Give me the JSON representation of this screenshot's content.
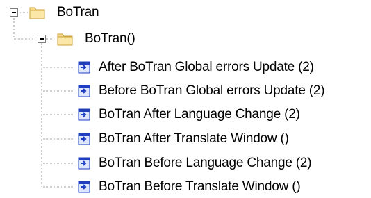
{
  "tree": {
    "root": {
      "label": "BoTran",
      "icon": "folder-icon",
      "expanded": true,
      "children": [
        {
          "label": "BoTran()",
          "icon": "folder-icon",
          "expanded": true,
          "children": [
            {
              "label": "After BoTran Global errors Update (2)",
              "icon": "item-icon"
            },
            {
              "label": "Before BoTran Global errors Update (2)",
              "icon": "item-icon"
            },
            {
              "label": "BoTran After Language Change (2)",
              "icon": "item-icon"
            },
            {
              "label": "BoTran After Translate Window ()",
              "icon": "item-icon"
            },
            {
              "label": "BoTran Before Language Change (2)",
              "icon": "item-icon"
            },
            {
              "label": "BoTran Before Translate Window ()",
              "icon": "item-icon"
            }
          ]
        }
      ]
    }
  },
  "colors": {
    "folder_fill": "#f5d98a",
    "folder_dark": "#c9a23a",
    "item_blue": "#1f3fbf",
    "tree_line": "#a0a0a0"
  }
}
